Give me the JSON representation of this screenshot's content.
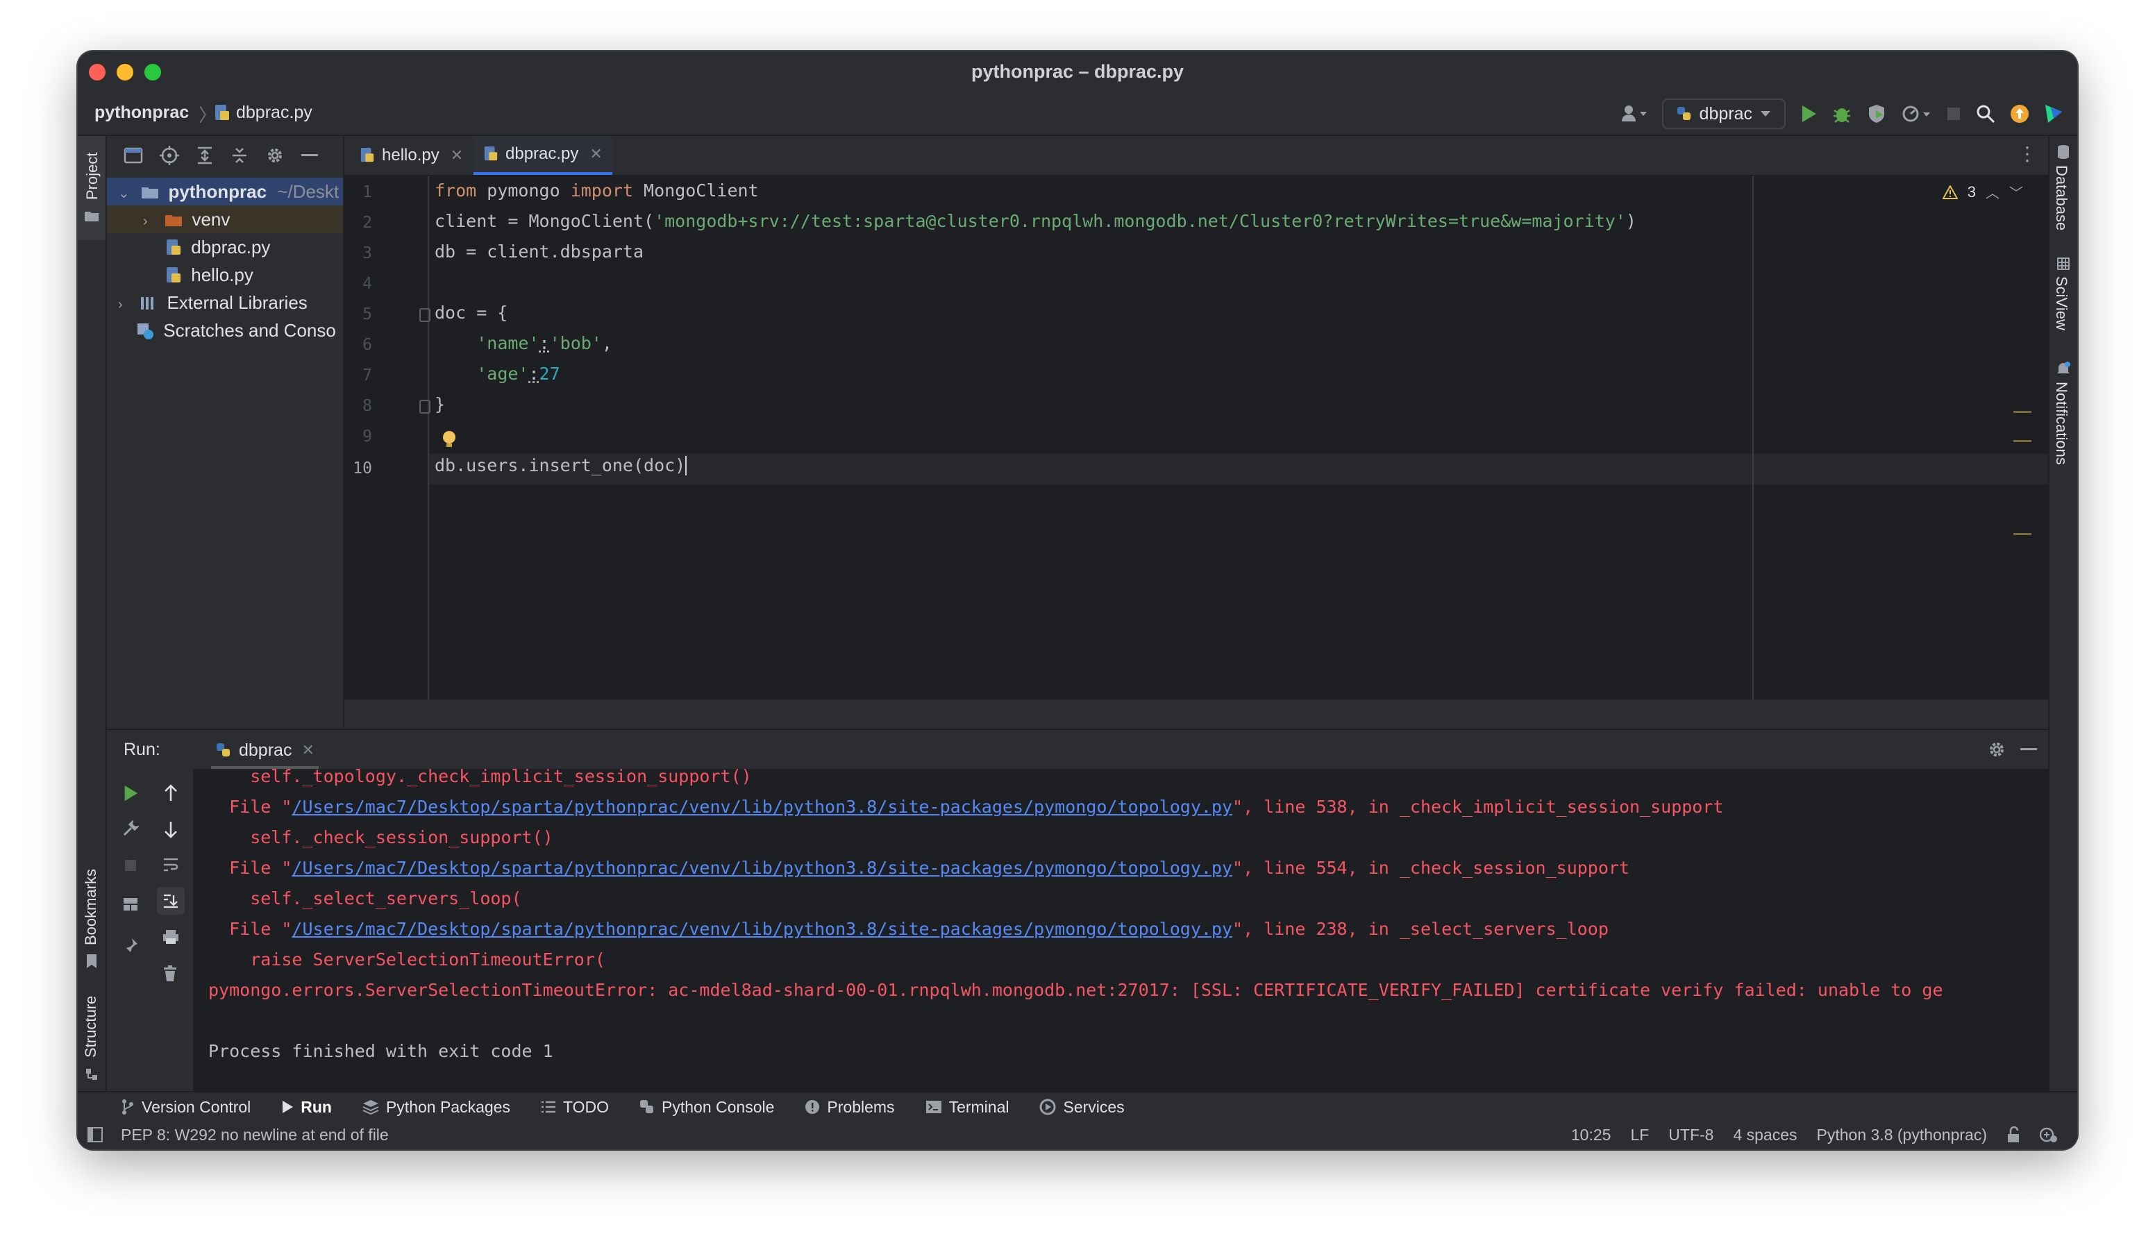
{
  "window": {
    "title": "pythonprac – dbprac.py"
  },
  "navbar": {
    "project": "pythonprac",
    "file": "dbprac.py",
    "run_config": "dbprac"
  },
  "left_strip": {
    "project_label": "Project",
    "bookmarks_label": "Bookmarks",
    "structure_label": "Structure"
  },
  "right_strip": {
    "database_label": "Database",
    "sciview_label": "SciView",
    "notifications_label": "Notifications"
  },
  "project_tree": {
    "root_name": "pythonprac",
    "root_path": "~/Deskt",
    "items": [
      {
        "label": "venv"
      },
      {
        "label": "dbprac.py"
      },
      {
        "label": "hello.py"
      },
      {
        "label": "External Libraries"
      },
      {
        "label": "Scratches and Conso"
      }
    ]
  },
  "editor": {
    "tabs": [
      {
        "label": "hello.py"
      },
      {
        "label": "dbprac.py"
      }
    ],
    "warnings_count": "3",
    "line_numbers": [
      "1",
      "2",
      "3",
      "4",
      "5",
      "6",
      "7",
      "8",
      "9",
      "10"
    ],
    "code": {
      "l1_from": "from",
      "l1_mod": " pymongo ",
      "l1_import": "import",
      "l1_cls": " MongoClient",
      "l2_pre": "client = MongoClient(",
      "l2_str": "'mongodb+srv://test:sparta@cluster0.rnpqlwh.mongodb.net/Cluster0?retryWrites=true&w=majority'",
      "l2_post": ")",
      "l3": "db = client.dbsparta",
      "l5": "doc = {",
      "l6_key": "'name'",
      "l6_colon": ":",
      "l6_val": "'bob'",
      "l6_comma": ",",
      "l7_key": "'age'",
      "l7_colon": ":",
      "l7_val": "27",
      "l8": "}",
      "l10": "db.users.insert_one(doc)"
    }
  },
  "run_panel": {
    "title": "Run:",
    "tab": "dbprac",
    "output": [
      {
        "pre": "    self._topology._check_implicit_session_support()"
      },
      {
        "pre": "  File \"",
        "link": "/Users/mac7/Desktop/sparta/pythonprac/venv/lib/python3.8/site-packages/pymongo/topology.py",
        "post": "\", line 538, in _check_implicit_session_support"
      },
      {
        "pre": "    self._check_session_support()"
      },
      {
        "pre": "  File \"",
        "link": "/Users/mac7/Desktop/sparta/pythonprac/venv/lib/python3.8/site-packages/pymongo/topology.py",
        "post": "\", line 554, in _check_session_support"
      },
      {
        "pre": "    self._select_servers_loop("
      },
      {
        "pre": "  File \"",
        "link": "/Users/mac7/Desktop/sparta/pythonprac/venv/lib/python3.8/site-packages/pymongo/topology.py",
        "post": "\", line 238, in _select_servers_loop"
      },
      {
        "pre": "    raise ServerSelectionTimeoutError("
      },
      {
        "pre": "pymongo.errors.ServerSelectionTimeoutError: ac-mdel8ad-shard-00-01.rnpqlwh.mongodb.net:27017: [SSL: CERTIFICATE_VERIFY_FAILED] certificate verify failed: unable to ge"
      }
    ],
    "exit_message": "Process finished with exit code 1"
  },
  "tool_windows": [
    {
      "label": "Version Control",
      "icon": "branch-icon"
    },
    {
      "label": "Run",
      "icon": "play-icon"
    },
    {
      "label": "Python Packages",
      "icon": "layers-icon"
    },
    {
      "label": "TODO",
      "icon": "list-icon"
    },
    {
      "label": "Python Console",
      "icon": "python-icon"
    },
    {
      "label": "Problems",
      "icon": "info-icon"
    },
    {
      "label": "Terminal",
      "icon": "terminal-icon"
    },
    {
      "label": "Services",
      "icon": "services-icon"
    }
  ],
  "status_bar": {
    "message": "PEP 8: W292 no newline at end of file",
    "position": "10:25",
    "line_sep": "LF",
    "encoding": "UTF-8",
    "indent": "4 spaces",
    "interpreter": "Python 3.8 (pythonprac)"
  },
  "colors": {
    "error": "#f75464",
    "keyword": "#cf8e6d",
    "string": "#6aab73",
    "number": "#2aacb8",
    "link": "#548af7",
    "accent": "#3574f0"
  }
}
